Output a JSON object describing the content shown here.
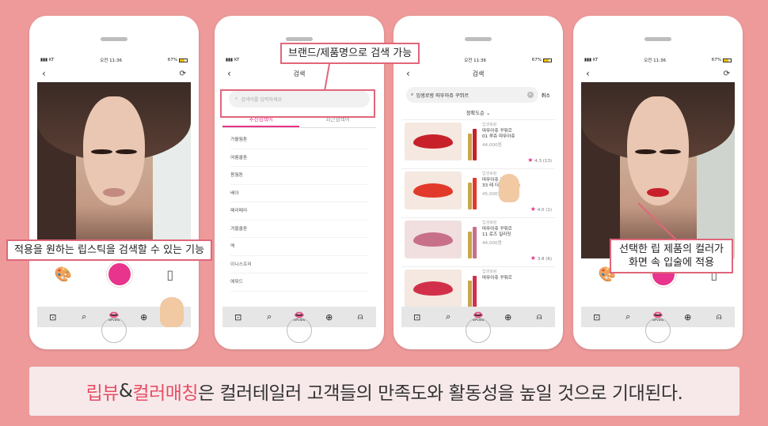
{
  "status": {
    "carrier": "KT",
    "time": "오전 11:36",
    "battery": "67%"
  },
  "tabbar": {
    "logo_text": "RIPVIEW"
  },
  "search_screen": {
    "title": "검색",
    "placeholder": "검색어를 입력하세요",
    "tabs": [
      "추천검색어",
      "최근검색어"
    ],
    "keywords": [
      "가을웜톤",
      "여름쿨톤",
      "봄웜톤",
      "베아",
      "페리페라",
      "겨울쿨톤",
      "맥",
      "이니스프리",
      "에뛰드"
    ]
  },
  "results_screen": {
    "title": "검색",
    "query": "입생로랑 따뚜아쥬 꾸뛰르",
    "cancel": "취소",
    "sort": "정확도순",
    "products": [
      {
        "brand": "입생로랑",
        "name1": "따뚜아쥬 꾸뛰르",
        "name2": "01 루쥬 따뚜아쥬",
        "price": "44,000원",
        "rating": "4.3",
        "count": "(13)",
        "color": "#c8202a"
      },
      {
        "brand": "입생로랑",
        "name1": "따뚜아쥬 꾸뛰르",
        "name2": "33 레 더 스캔들러스",
        "price": "45,000원",
        "rating": "4.0",
        "count": "(1)",
        "color": "#e23a2a"
      },
      {
        "brand": "입생로랑",
        "name1": "따뚜아쥬 꾸뛰르",
        "name2": "11 로즈 일리짓",
        "price": "44,000원",
        "rating": "3.8",
        "count": "(6)",
        "color": "#c8708a"
      },
      {
        "brand": "입생로랑",
        "name1": "따뚜아쥬 꾸뛰르",
        "name2": "",
        "price": "",
        "rating": "",
        "count": "",
        "color": "#d2304a"
      }
    ]
  },
  "callouts": {
    "search_feature": "적용을 원하는 립스틱을 검색할 수 있는 기능",
    "brand_search": "브랜드/제품명으로 검색 가능",
    "color_apply_line1": "선택한 립 제품의 컬러가",
    "color_apply_line2": "화면 속 입술에 적용"
  },
  "caption": {
    "part1": "립뷰",
    "part2": "&",
    "part3": "컬러매칭",
    "part4": "은 컬러테일러 고객들의 만족도와 활동성을 높일 것으로 기대된다."
  },
  "colors": {
    "background": "#ee9a9a",
    "accent": "#e8348c",
    "callout_border": "#e0667a",
    "caption_pink": "#e74d63"
  }
}
